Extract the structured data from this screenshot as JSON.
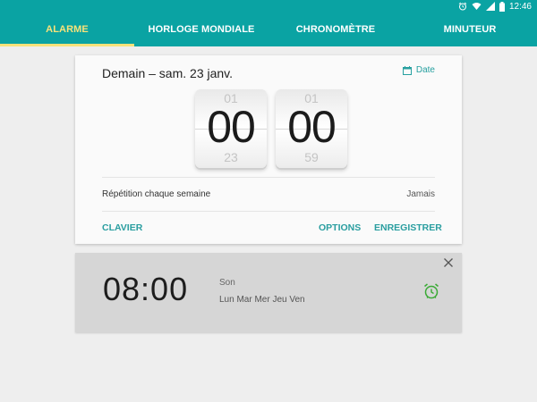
{
  "status_bar": {
    "time": "12:46",
    "icons": [
      "alarm-icon",
      "wifi-icon",
      "signal-icon",
      "battery-icon"
    ]
  },
  "tabs": [
    {
      "label": "ALARME",
      "active": true
    },
    {
      "label": "HORLOGE MONDIALE",
      "active": false
    },
    {
      "label": "CHRONOMÈTRE",
      "active": false
    },
    {
      "label": "MINUTEUR",
      "active": false
    }
  ],
  "edit_card": {
    "title": "Demain – sam. 23 janv.",
    "date_button": "Date",
    "hours": {
      "previous": "01",
      "current": "00",
      "next": "23"
    },
    "minutes": {
      "previous": "01",
      "current": "00",
      "next": "59"
    },
    "repeat_label": "Répétition chaque semaine",
    "repeat_value": "Jamais",
    "actions": {
      "keyboard": "CLAVIER",
      "options": "OPTIONS",
      "save": "ENREGISTRER"
    }
  },
  "alarm": {
    "time": "08:00",
    "sound": "Son",
    "days": "Lun Mar Mer Jeu Ven",
    "enabled": true
  },
  "colors": {
    "primary": "#0aa3a3",
    "tab_active": "#f7e27a",
    "action_text": "#2a9ea0",
    "alarm_on": "#3aaa35"
  }
}
